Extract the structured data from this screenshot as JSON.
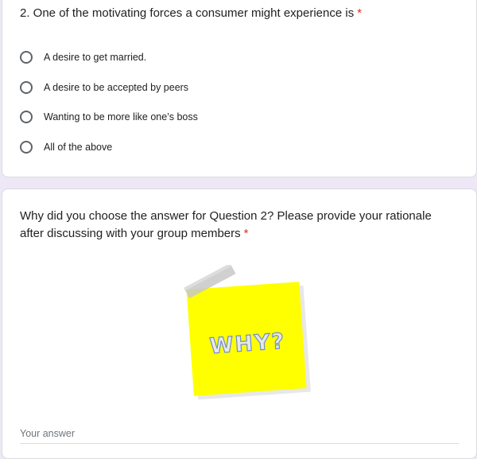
{
  "question2": {
    "title": "2. One of the motivating forces a consumer might experience is",
    "required_mark": "*",
    "options": [
      {
        "label": "A desire to get married."
      },
      {
        "label": "A desire to be accepted by peers"
      },
      {
        "label": "Wanting to be more like one’s boss"
      },
      {
        "label": "All of the above"
      }
    ]
  },
  "rationale_question": {
    "title": "Why did you choose the answer for Question 2? Please provide your rationale after discussing with your group members",
    "required_mark": "*",
    "image_text": "WHY?",
    "answer_placeholder": "Your answer"
  },
  "colors": {
    "page_background": "#ede7f6",
    "required": "#d93025",
    "sticky_note": "#ffff00",
    "radio_border": "#5f6368"
  }
}
